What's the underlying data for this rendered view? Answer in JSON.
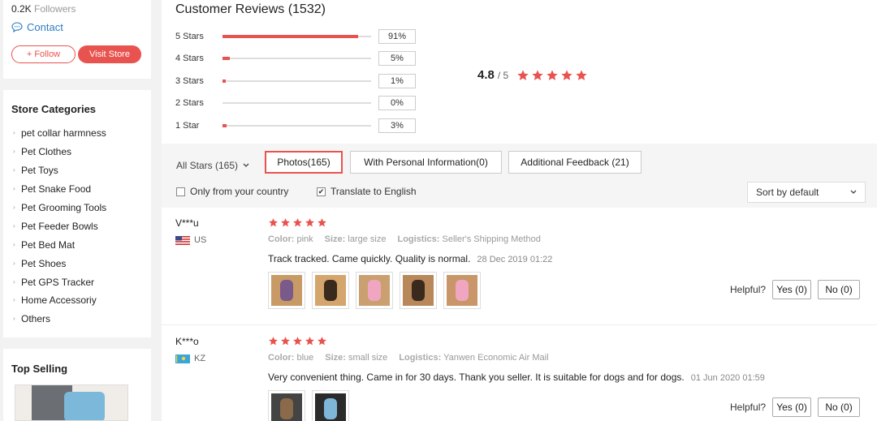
{
  "store": {
    "followers_count": "0.2K",
    "followers_label": "Followers",
    "contact_label": "Contact",
    "follow_label": "+ Follow",
    "visit_label": "Visit Store"
  },
  "categories": {
    "title": "Store Categories",
    "items": [
      "pet collar harmness",
      "Pet Clothes",
      "Pet Toys",
      "Pet Snake Food",
      "Pet Grooming Tools",
      "Pet Feeder Bowls",
      "Pet Bed Mat",
      "Pet Shoes",
      "Pet GPS Tracker",
      "Home Accessoriy",
      "Others"
    ]
  },
  "top_selling": {
    "title": "Top Selling"
  },
  "reviews": {
    "title": "Customer Reviews (1532)",
    "distribution": [
      {
        "label": "5 Stars",
        "pct_text": "91%",
        "fraction": 0.91
      },
      {
        "label": "4 Stars",
        "pct_text": "5%",
        "fraction": 0.05
      },
      {
        "label": "3 Stars",
        "pct_text": "1%",
        "fraction": 0.01
      },
      {
        "label": "2 Stars",
        "pct_text": "0%",
        "fraction": 0.0
      },
      {
        "label": "1 Star",
        "pct_text": "3%",
        "fraction": 0.03
      }
    ],
    "rating_value": "4.8",
    "rating_max": "/ 5",
    "rating_stars": 5,
    "star_color": "#e8534f"
  },
  "filters": {
    "all_stars": "All Stars (165)",
    "photos": "Photos(165)",
    "personal": "With Personal Information(0)",
    "additional": "Additional Feedback (21)",
    "only_country": "Only from your country",
    "translate": "Translate to English",
    "sort": "Sort by default"
  },
  "review_list": [
    {
      "name": "V***u",
      "country": "US",
      "stars": 5,
      "color_label": "Color:",
      "color": "pink",
      "size_label": "Size:",
      "size": "large size",
      "logistics_label": "Logistics:",
      "logistics": "Seller's Shipping Method",
      "text": "Track tracked. Came quickly. Quality is normal.",
      "date": "28 Dec 2019 01:22",
      "photos": 5,
      "helpful_label": "Helpful?",
      "yes": "Yes (0)",
      "no": "No (0)"
    },
    {
      "name": "K***o",
      "country": "KZ",
      "stars": 5,
      "color_label": "Color:",
      "color": "blue",
      "size_label": "Size:",
      "size": "small size",
      "logistics_label": "Logistics:",
      "logistics": "Yanwen Economic Air Mail",
      "text": "Very convenient thing. Came in for 30 days. Thank you seller. It is suitable for dogs and for dogs.",
      "date": "01 Jun 2020 01:59",
      "photos": 2,
      "helpful_label": "Helpful?",
      "yes": "Yes (0)",
      "no": "No (0)"
    }
  ]
}
